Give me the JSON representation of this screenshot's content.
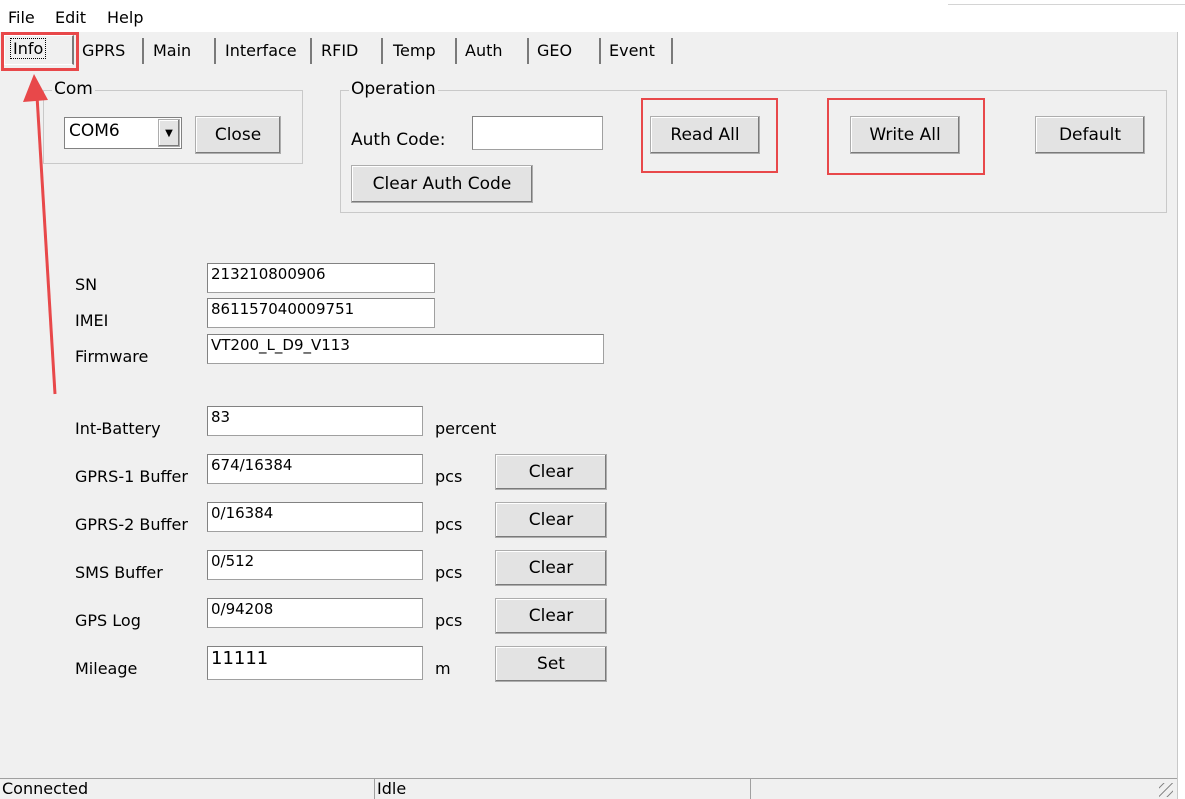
{
  "menu": [
    "File",
    "Edit",
    "Help"
  ],
  "tabs": [
    "Info",
    "GPRS",
    "Main",
    "Interface",
    "RFID",
    "Temp",
    "Auth",
    "GEO",
    "Event"
  ],
  "com": {
    "title": "Com",
    "port": "COM6",
    "close_label": "Close"
  },
  "operation": {
    "title": "Operation",
    "auth_label": "Auth Code:",
    "auth_value": "",
    "read_all": "Read All",
    "write_all": "Write All",
    "default": "Default",
    "clear_auth": "Clear Auth Code"
  },
  "info": {
    "sn_label": "SN",
    "sn": "213210800906",
    "imei_label": "IMEI",
    "imei": "861157040009751",
    "fw_label": "Firmware",
    "fw": "VT200_L_D9_V113"
  },
  "stats": [
    {
      "label": "Int-Battery",
      "value": "83",
      "unit": "percent",
      "button": ""
    },
    {
      "label": "GPRS-1 Buffer",
      "value": "674/16384",
      "unit": "pcs",
      "button": "Clear"
    },
    {
      "label": "GPRS-2 Buffer",
      "value": "0/16384",
      "unit": "pcs",
      "button": "Clear"
    },
    {
      "label": "SMS Buffer",
      "value": "0/512",
      "unit": "pcs",
      "button": "Clear"
    },
    {
      "label": "GPS Log",
      "value": "0/94208",
      "unit": "pcs",
      "button": "Clear"
    },
    {
      "label": "Mileage",
      "value": "11111",
      "unit": "m",
      "button": "Set"
    }
  ],
  "status": {
    "left": "Connected",
    "middle": "Idle"
  },
  "colors": {
    "highlight": "#e8484a",
    "window_bg": "#f0f0f0"
  }
}
